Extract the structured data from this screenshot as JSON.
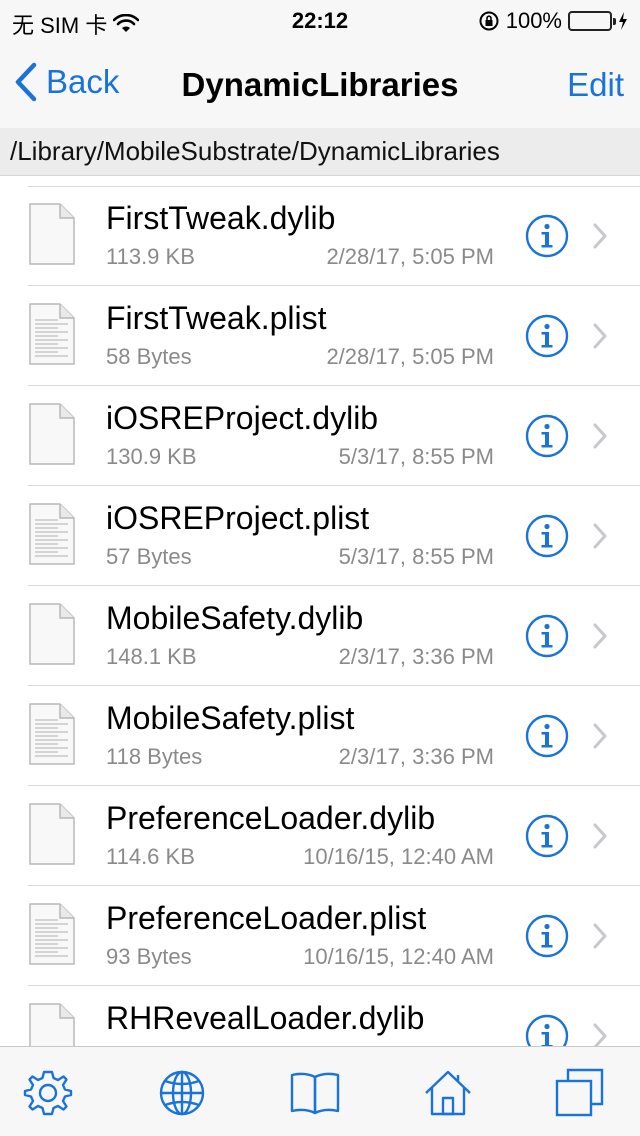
{
  "status": {
    "carrier": "无 SIM 卡",
    "time": "22:12",
    "battery": "100%"
  },
  "nav": {
    "back_label": "Back",
    "title": "DynamicLibraries",
    "edit_label": "Edit"
  },
  "path": "/Library/MobileSubstrate/DynamicLibraries",
  "files": [
    {
      "name": "FirstTweak.dylib",
      "size": "113.9 KB",
      "date": "2/28/17, 5:05 PM",
      "kind": "dylib"
    },
    {
      "name": "FirstTweak.plist",
      "size": "58 Bytes",
      "date": "2/28/17, 5:05 PM",
      "kind": "plist"
    },
    {
      "name": "iOSREProject.dylib",
      "size": "130.9 KB",
      "date": "5/3/17, 8:55 PM",
      "kind": "dylib"
    },
    {
      "name": "iOSREProject.plist",
      "size": "57 Bytes",
      "date": "5/3/17, 8:55 PM",
      "kind": "plist"
    },
    {
      "name": "MobileSafety.dylib",
      "size": "148.1 KB",
      "date": "2/3/17, 3:36 PM",
      "kind": "dylib"
    },
    {
      "name": "MobileSafety.plist",
      "size": "118 Bytes",
      "date": "2/3/17, 3:36 PM",
      "kind": "plist"
    },
    {
      "name": "PreferenceLoader.dylib",
      "size": "114.6 KB",
      "date": "10/16/15, 12:40 AM",
      "kind": "dylib"
    },
    {
      "name": "PreferenceLoader.plist",
      "size": "93 Bytes",
      "date": "10/16/15, 12:40 AM",
      "kind": "plist"
    },
    {
      "name": "RHRevealLoader.dylib",
      "size": "",
      "date": "",
      "kind": "dylib"
    }
  ],
  "tabs": [
    {
      "icon": "gear-icon"
    },
    {
      "icon": "globe-icon"
    },
    {
      "icon": "book-icon"
    },
    {
      "icon": "home-icon"
    },
    {
      "icon": "windows-icon"
    }
  ],
  "colors": {
    "accent": "#1a73d9",
    "battery": "#4cd964"
  }
}
